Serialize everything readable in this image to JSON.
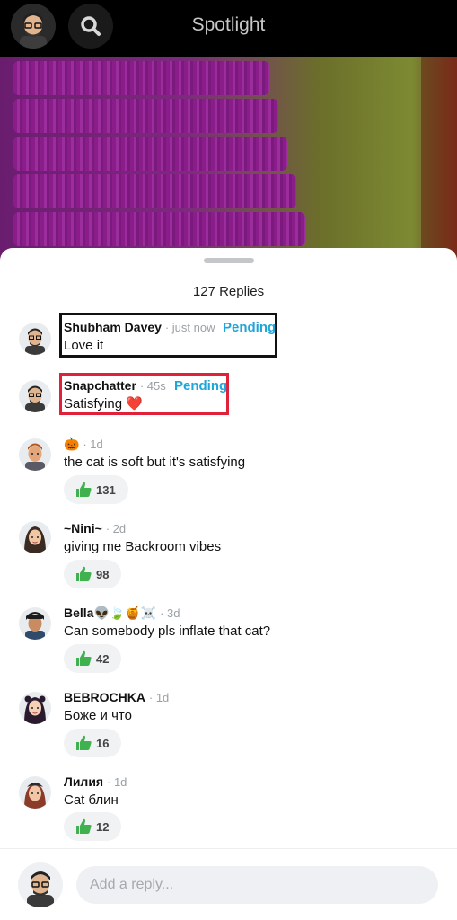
{
  "header": {
    "title": "Spotlight",
    "profile_icon": "bitmoji-avatar-icon",
    "search_icon": "search-icon"
  },
  "sheet": {
    "replies_count": "127 Replies"
  },
  "comments": [
    {
      "name": "Shubham Davey",
      "meta": "· just now",
      "text": "Love it",
      "status": "Pending"
    },
    {
      "name": "Snapchatter",
      "meta": "· 45s",
      "text": "Satisfying ❤️",
      "status": "Pending"
    },
    {
      "name": "🎃",
      "meta": "· 1d",
      "text": "the cat is soft but it's satisfying",
      "likes": "131"
    },
    {
      "name": "~Nini~",
      "meta": "· 2d",
      "text": "giving me Backroom vibes",
      "likes": "98"
    },
    {
      "name": "Bella👽🍃🍯☠️",
      "meta": "· 3d",
      "text": "Can somebody pls inflate that cat?",
      "likes": "42"
    },
    {
      "name": "BEBROCHKA",
      "meta": "· 1d",
      "text": "Боже и что",
      "likes": "16"
    },
    {
      "name": "Лилия",
      "meta": "· 1d",
      "text": "Cat блин",
      "likes": "12"
    }
  ],
  "reply_bar": {
    "placeholder": "Add a reply..."
  },
  "colors": {
    "pending": "#1fa6d8",
    "like_green": "#3fb24f",
    "highlight_black": "#111111",
    "highlight_red": "#e0213a"
  }
}
